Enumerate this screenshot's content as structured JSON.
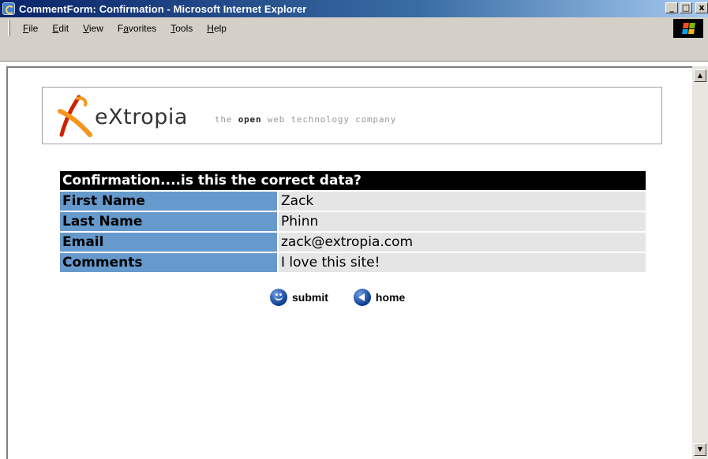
{
  "window": {
    "title": "CommentForm: Confirmation - Microsoft Internet Explorer",
    "controls": {
      "minimize": "_",
      "maximize": "□",
      "close": "x"
    }
  },
  "menu": {
    "items": [
      {
        "label_pre": "",
        "accel": "F",
        "label_post": "ile"
      },
      {
        "label_pre": "",
        "accel": "E",
        "label_post": "dit"
      },
      {
        "label_pre": "",
        "accel": "V",
        "label_post": "iew"
      },
      {
        "label_pre": "F",
        "accel": "a",
        "label_post": "vorites"
      },
      {
        "label_pre": "",
        "accel": "T",
        "label_post": "ools"
      },
      {
        "label_pre": "",
        "accel": "H",
        "label_post": "elp"
      }
    ]
  },
  "logo": {
    "wordmark": "eXtropia",
    "tagline_pre": "the ",
    "tagline_bold": "open",
    "tagline_post": " web technology company",
    "colors": {
      "x_orange": "#f7941d",
      "x_red": "#cc2200"
    }
  },
  "confirmation": {
    "header": "Confirmation....is this the correct data?",
    "rows": [
      {
        "label": "First Name",
        "value": "Zack"
      },
      {
        "label": "Last Name",
        "value": "Phinn"
      },
      {
        "label": "Email",
        "value": "zack@extropia.com"
      },
      {
        "label": "Comments",
        "value": "I love this site!"
      }
    ],
    "colors": {
      "header_bg": "#000000",
      "label_bg": "#6699cc",
      "value_bg": "#e5e5e5"
    }
  },
  "actions": {
    "submit": {
      "label": "submit",
      "icon": "smiley-icon"
    },
    "home": {
      "label": "home",
      "icon": "back-arrow-icon"
    }
  },
  "scrollbar": {
    "up": "▲",
    "down": "▼"
  }
}
